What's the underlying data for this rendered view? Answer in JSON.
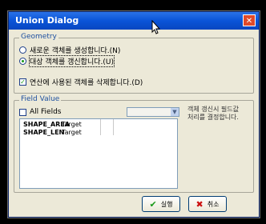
{
  "window": {
    "title": "Union Dialog"
  },
  "geometry": {
    "legend": "Geometry",
    "options": [
      {
        "label": "새로운 객체를 생성합니다.(N)",
        "selected": false
      },
      {
        "label": "대상 객체를 갱신합니다.(U)",
        "selected": true
      }
    ],
    "delete_label": "연산에 사용된 객체를 삭제합니다.(D)",
    "delete_checked": true
  },
  "field_value": {
    "legend": "Field Value",
    "all_fields_label": "All Fields",
    "all_fields_checked": false,
    "combo_value": "",
    "note": "객체 갱신시 필드값 처리를 결정합니다.",
    "rows": [
      {
        "field": "SHAPE_AREA",
        "value": "Target"
      },
      {
        "field": "SHAPE_LEN",
        "value": "Target"
      }
    ]
  },
  "buttons": {
    "ok": "실행",
    "cancel": "취소"
  },
  "colors": {
    "titlebar": "#0a54d8",
    "ok_icon": "#1a9a1a",
    "cancel_icon": "#cc1111"
  }
}
